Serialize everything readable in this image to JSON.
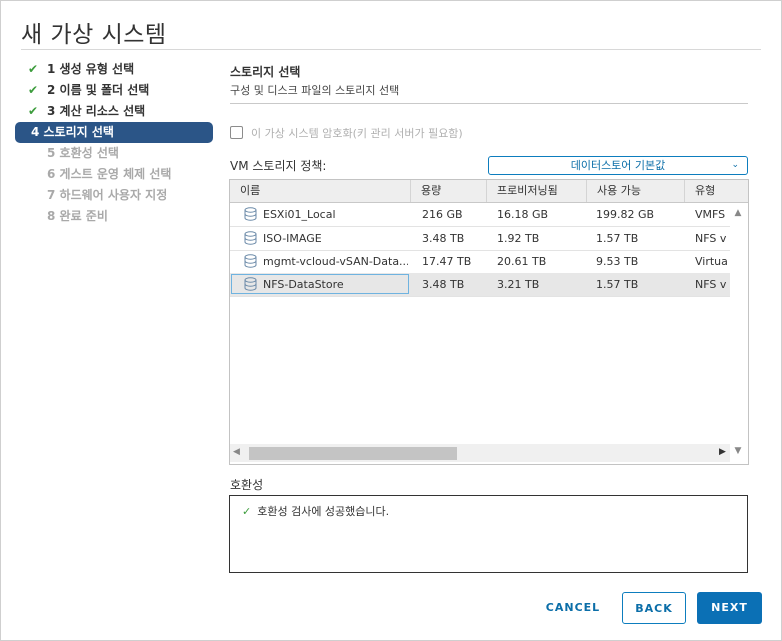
{
  "window": {
    "title": "새 가상 시스템"
  },
  "steps": [
    {
      "label": "1 생성 유형 선택",
      "state": "done"
    },
    {
      "label": "2 이름 및 폴더 선택",
      "state": "done"
    },
    {
      "label": "3 계산 리소스 선택",
      "state": "done"
    },
    {
      "label": "4 스토리지 선택",
      "state": "active"
    },
    {
      "label": "5 호환성 선택",
      "state": "pending"
    },
    {
      "label": "6 게스트 운영 체제 선택",
      "state": "pending"
    },
    {
      "label": "7 하드웨어 사용자 지정",
      "state": "pending"
    },
    {
      "label": "8 완료 준비",
      "state": "pending"
    }
  ],
  "section": {
    "title": "스토리지 선택",
    "subtitle": "구성 및 디스크 파일의 스토리지 선택"
  },
  "encrypt": {
    "label": "이 가상 시스템 암호화(키 관리 서버가 필요함)",
    "checked": false
  },
  "policy": {
    "label": "VM 스토리지 정책:",
    "value": "데이터스토어 기본값"
  },
  "grid": {
    "columns": [
      "이름",
      "용량",
      "프로비저닝됨",
      "사용 가능",
      "유형"
    ],
    "rows": [
      {
        "name": "ESXi01_Local",
        "capacity": "216 GB",
        "provisioned": "16.18 GB",
        "free": "199.82 GB",
        "type": "VMFS",
        "selected": false
      },
      {
        "name": "ISO-IMAGE",
        "capacity": "3.48 TB",
        "provisioned": "1.92 TB",
        "free": "1.57 TB",
        "type": "NFS v",
        "selected": false
      },
      {
        "name": "mgmt-vcloud-vSAN-Data...",
        "capacity": "17.47 TB",
        "provisioned": "20.61 TB",
        "free": "9.53 TB",
        "type": "Virtua",
        "selected": false
      },
      {
        "name": "NFS-DataStore",
        "capacity": "3.48 TB",
        "provisioned": "3.21 TB",
        "free": "1.57 TB",
        "type": "NFS v",
        "selected": true
      }
    ]
  },
  "compat": {
    "label": "호환성",
    "message": "호환성 검사에 성공했습니다."
  },
  "buttons": {
    "cancel": "CANCEL",
    "back": "BACK",
    "next": "NEXT"
  },
  "colors": {
    "accent": "#0b70b5",
    "active_step": "#2b5587",
    "success": "#3c9c3c"
  }
}
